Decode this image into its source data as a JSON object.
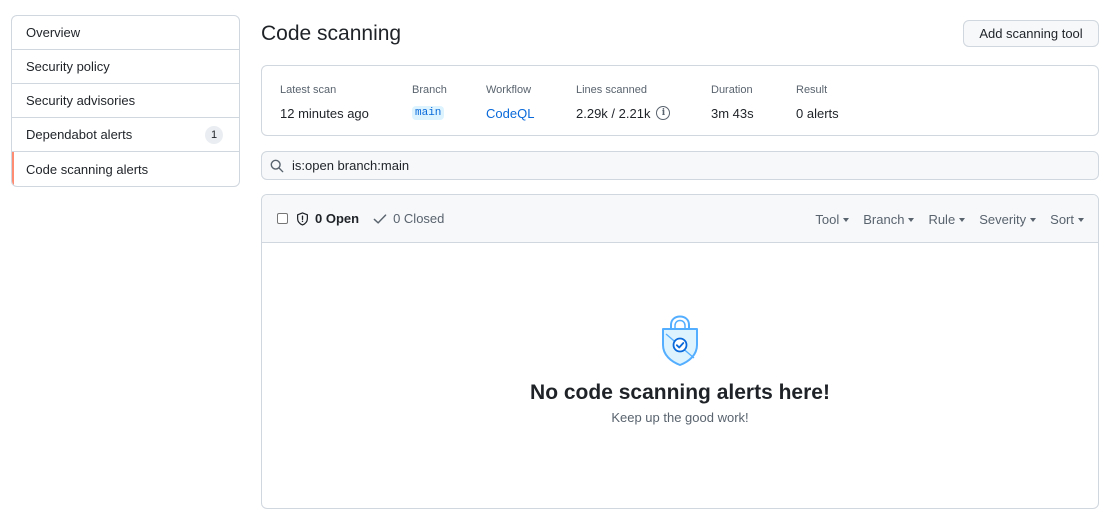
{
  "sidebar": {
    "items": [
      {
        "label": "Overview"
      },
      {
        "label": "Security policy"
      },
      {
        "label": "Security advisories"
      },
      {
        "label": "Dependabot alerts",
        "count": "1"
      },
      {
        "label": "Code scanning alerts",
        "active": true
      }
    ]
  },
  "header": {
    "title": "Code scanning",
    "add_button": "Add scanning tool"
  },
  "summary": {
    "latest_scan_label": "Latest scan",
    "latest_scan_value": "12 minutes ago",
    "branch_label": "Branch",
    "branch_value": "main",
    "workflow_label": "Workflow",
    "workflow_value": "CodeQL",
    "lines_label": "Lines scanned",
    "lines_value": "2.29k / 2.21k",
    "duration_label": "Duration",
    "duration_value": "3m 43s",
    "result_label": "Result",
    "result_value": "0 alerts"
  },
  "search": {
    "value": "is:open branch:main"
  },
  "alerts": {
    "open_label": "0 Open",
    "closed_label": "0 Closed",
    "filters": [
      "Tool",
      "Branch",
      "Rule",
      "Severity",
      "Sort"
    ],
    "empty_title": "No code scanning alerts here!",
    "empty_subtitle": "Keep up the good work!"
  },
  "colors": {
    "accent": "#0969da",
    "active_indicator": "#fd8c73",
    "empty_icon": "#54aeff"
  },
  "icons": [
    "search-icon",
    "shield-icon",
    "check-icon",
    "info-icon",
    "security-shield-check-icon"
  ]
}
